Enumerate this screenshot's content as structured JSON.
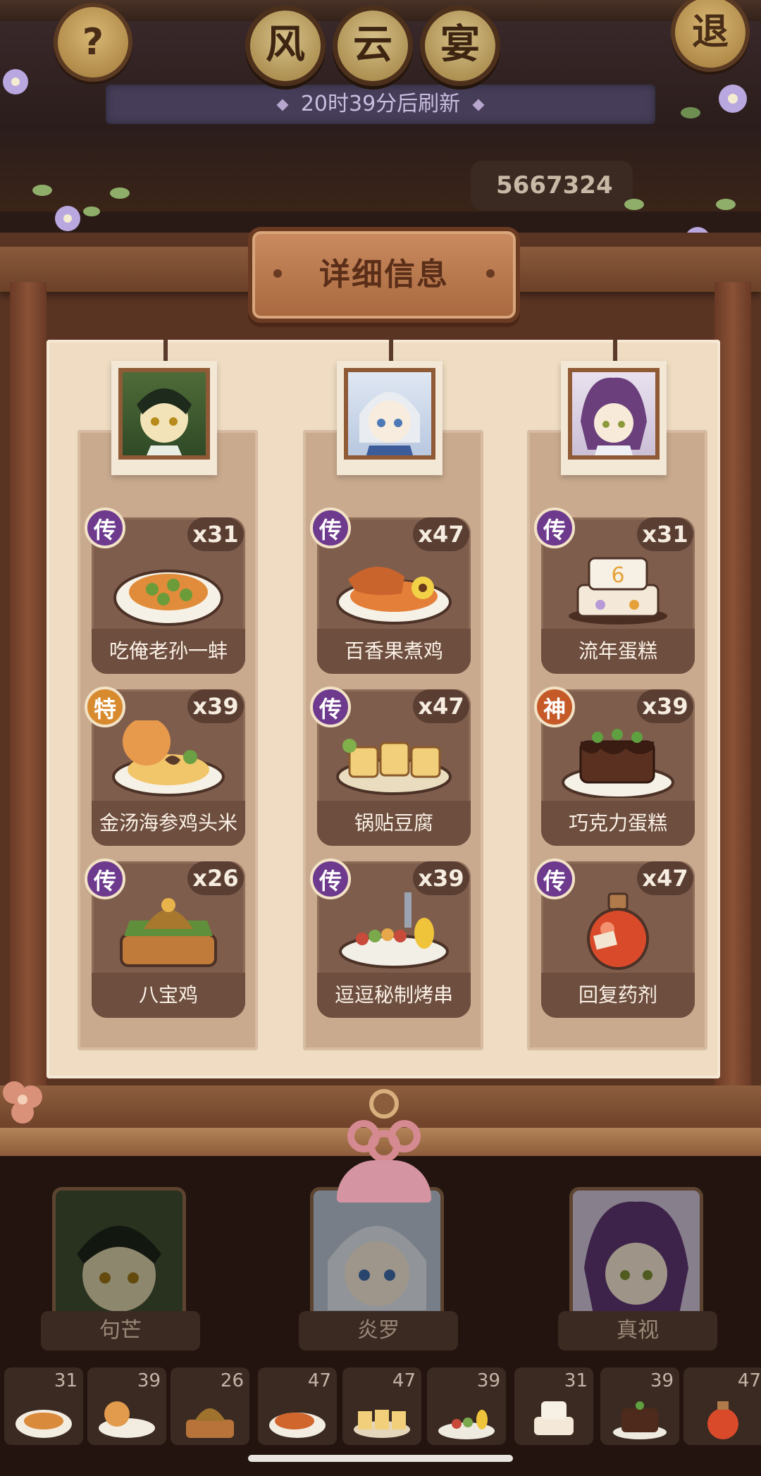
{
  "header": {
    "help_label": "?",
    "title_chars": [
      "风",
      "云",
      "宴"
    ],
    "exit_label": "退",
    "refresh_text": "20时39分后刷新",
    "score": "5667324"
  },
  "panel": {
    "title": "详细信息"
  },
  "columns": [
    {
      "character": "句芒",
      "dishes": [
        {
          "name": "吃俺老孙一蚌",
          "qty": "x31",
          "rarity": "传"
        },
        {
          "name": "金汤海参鸡头米",
          "qty": "x39",
          "rarity": "特"
        },
        {
          "name": "八宝鸡",
          "qty": "x26",
          "rarity": "传"
        }
      ]
    },
    {
      "character": "炎罗",
      "dishes": [
        {
          "name": "百香果煮鸡",
          "qty": "x47",
          "rarity": "传"
        },
        {
          "name": "锅贴豆腐",
          "qty": "x47",
          "rarity": "传"
        },
        {
          "name": "逗逗秘制烤串",
          "qty": "x39",
          "rarity": "传"
        }
      ]
    },
    {
      "character": "真视",
      "dishes": [
        {
          "name": "流年蛋糕",
          "qty": "x31",
          "rarity": "传"
        },
        {
          "name": "巧克力蛋糕",
          "qty": "x39",
          "rarity": "神"
        },
        {
          "name": "回复药剂",
          "qty": "x47",
          "rarity": "传"
        }
      ]
    }
  ],
  "food_bar": [
    "31",
    "39",
    "26",
    "47",
    "47",
    "39",
    "31",
    "39",
    "47"
  ],
  "colors": {
    "legend_badge": "#6e3a8e",
    "special_badge": "#d78a2e",
    "god_badge": "#c55a28",
    "card_bg": "#7f5d4c",
    "board_bg": "#efdcc2"
  }
}
